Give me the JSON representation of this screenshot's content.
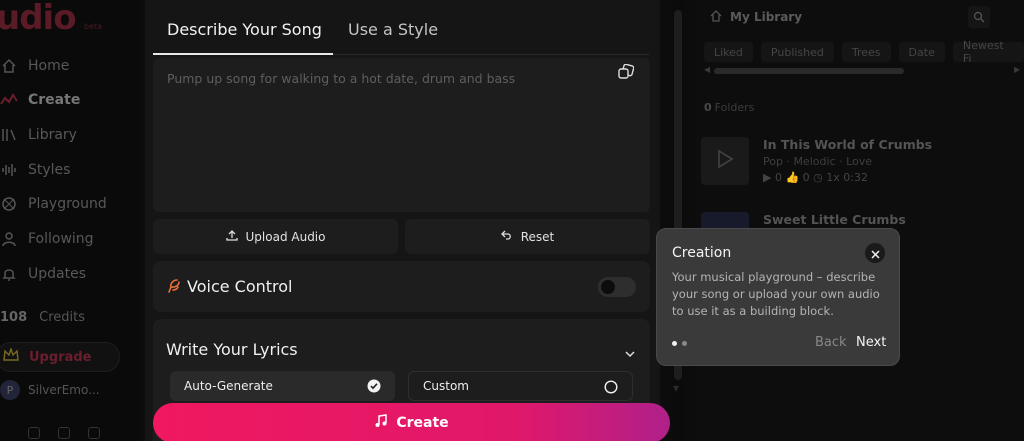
{
  "brand": {
    "logo": "udio",
    "beta": "beta"
  },
  "sidebar": {
    "items": [
      {
        "label": "Home",
        "icon": "home-icon"
      },
      {
        "label": "Create",
        "icon": "create-icon"
      },
      {
        "label": "Library",
        "icon": "library-icon"
      },
      {
        "label": "Styles",
        "icon": "styles-icon"
      },
      {
        "label": "Playground",
        "icon": "playground-icon"
      },
      {
        "label": "Following",
        "icon": "following-icon"
      },
      {
        "label": "Updates",
        "icon": "bell-icon"
      }
    ],
    "credits_count": "108",
    "credits_label": "Credits",
    "upgrade_label": "Upgrade",
    "user_initial": "P",
    "user_name": "SilverEmo..."
  },
  "main": {
    "tabs": [
      {
        "label": "Describe Your Song"
      },
      {
        "label": "Use a Style"
      }
    ],
    "description_placeholder": "Pump up song for walking to a hot date, drum and bass",
    "upload_label": "Upload Audio",
    "reset_label": "Reset",
    "voice_control_label": "Voice Control",
    "lyrics_title": "Write Your Lyrics",
    "lyrics_options": [
      {
        "label": "Auto-Generate",
        "selected": true
      },
      {
        "label": "Custom",
        "selected": false
      }
    ],
    "create_label": "Create"
  },
  "library": {
    "title": "My Library",
    "filters": [
      "Liked",
      "Published",
      "Trees",
      "Date",
      "Newest Fi"
    ],
    "folders_count": "0",
    "folders_label": "Folders",
    "tracks": [
      {
        "title": "In This World of Crumbs",
        "tags": "Pop  ·  Melodic  ·  Love",
        "stats": "▶ 0   👍 0   ◷ 1x   0:32"
      },
      {
        "title": "Sweet Little Crumbs",
        "tags": "",
        "stats": ""
      }
    ]
  },
  "popover": {
    "title": "Creation",
    "body": "Your musical playground – describe your song or upload your own audio to use it as a building block.",
    "back_label": "Back",
    "next_label": "Next",
    "step": 1,
    "total_steps": 2
  },
  "colors": {
    "accent": "#f01860",
    "accent_end": "#b0208a",
    "voice_icon": "#e8703a",
    "panel": "#1d1d1d",
    "popover": "#3a3a3a"
  }
}
